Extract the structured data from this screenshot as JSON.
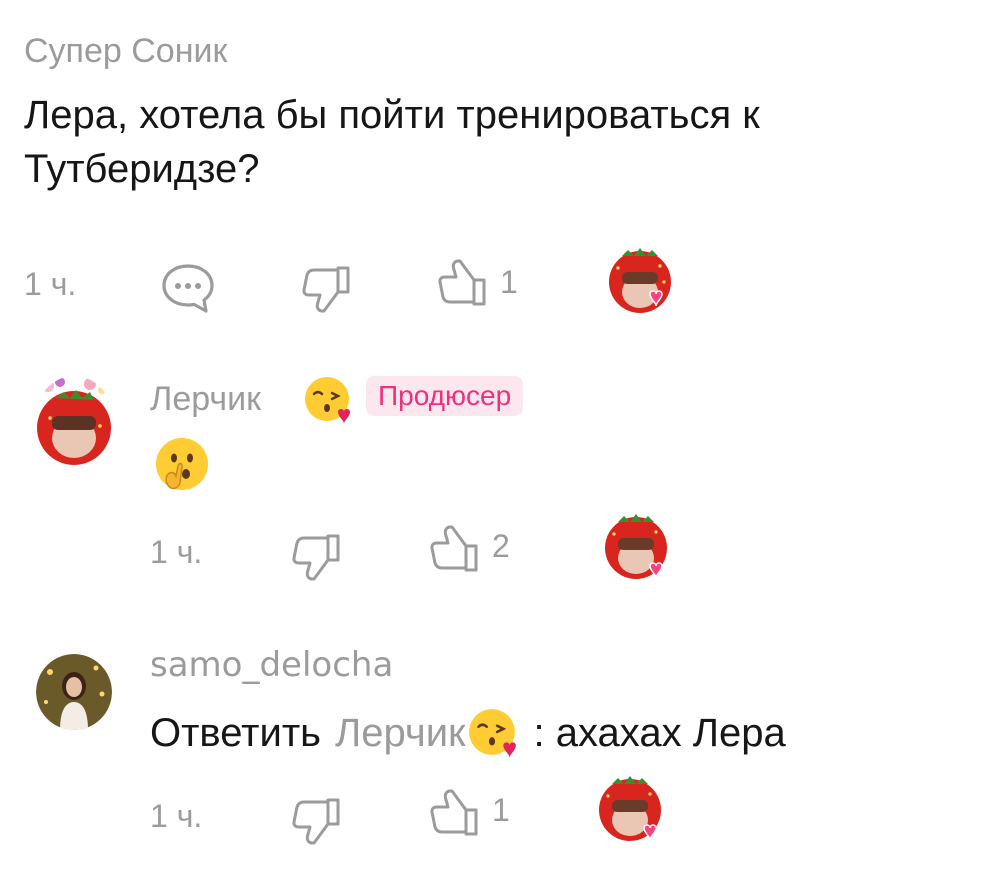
{
  "comments": [
    {
      "author": "Супер Соник",
      "text": "Лера, хотела бы пойти тренироваться к Тутберидзе?",
      "time": "1 ч.",
      "likes": "1"
    },
    {
      "author": "Лерчик",
      "author_emoji": "kissing-face-with-heart-emoji",
      "badge": "Продюсер",
      "text_emoji": "shushing-face-emoji",
      "time": "1 ч.",
      "likes": "2"
    },
    {
      "author": "samo_delocha",
      "reply_prefix": "Ответить",
      "reply_to": "Лерчик",
      "reply_to_emoji": "kissing-face-with-heart-emoji",
      "text": ": ахахах Лера",
      "time": "1 ч.",
      "likes": "1"
    }
  ],
  "colors": {
    "muted": "#9b9b9b",
    "text": "#161616",
    "badge_bg": "#fde7ee",
    "badge_text": "#f0307a",
    "strawberry": "#d8261f",
    "heart": "#ff3f7f"
  }
}
